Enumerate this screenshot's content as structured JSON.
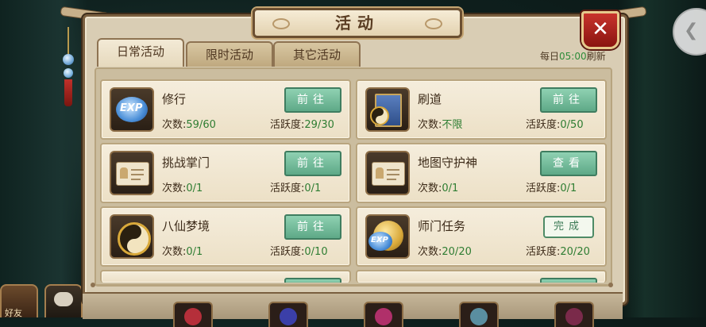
{
  "window": {
    "title": "活动"
  },
  "tabs": [
    {
      "label": "日常活动",
      "active": true
    },
    {
      "label": "限时活动",
      "active": false
    },
    {
      "label": "其它活动",
      "active": false
    }
  ],
  "refresh": {
    "prefix": "每日",
    "time": "05:00",
    "suffix": "刷新"
  },
  "labels": {
    "count": "次数:",
    "activity": "活跃度:"
  },
  "activities": [
    {
      "name": "修行",
      "count": "59/60",
      "activity": "29/30",
      "action": "前往",
      "icon": "exp-icon",
      "status": "go"
    },
    {
      "name": "刷道",
      "count": "不限",
      "activity": "0/50",
      "action": "前往",
      "icon": "taoist-book-icon",
      "status": "go"
    },
    {
      "name": "挑战掌门",
      "count": "0/1",
      "activity": "0/1",
      "action": "前往",
      "icon": "id-card-icon",
      "status": "go"
    },
    {
      "name": "地图守护神",
      "count": "0/1",
      "activity": "0/1",
      "action": "查看",
      "icon": "id-card-icon",
      "status": "view"
    },
    {
      "name": "八仙梦境",
      "count": "0/1",
      "activity": "0/10",
      "action": "前往",
      "icon": "yin-yang-icon",
      "status": "go"
    },
    {
      "name": "师门任务",
      "count": "20/20",
      "activity": "20/20",
      "action": "完成",
      "icon": "exp-coin-icon",
      "status": "done"
    }
  ],
  "side": {
    "friends_label": "好友"
  },
  "colors": {
    "accent_green": "#5ea987",
    "close_red": "#c8332c",
    "value_green": "#2e7d32"
  }
}
